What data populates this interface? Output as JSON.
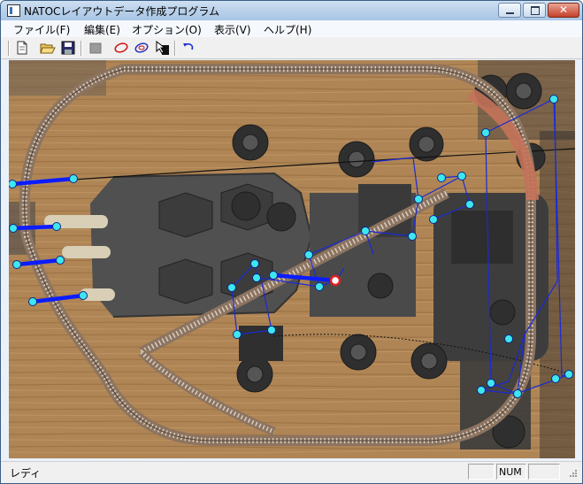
{
  "window": {
    "title": "NATOCレイアウトデータ作成プログラム",
    "close_glyph": "✕"
  },
  "menu": {
    "items": [
      {
        "label": "ファイル(F)"
      },
      {
        "label": "編集(E)"
      },
      {
        "label": "オプション(O)"
      },
      {
        "label": "表示(V)"
      },
      {
        "label": "ヘルプ(H)"
      }
    ]
  },
  "toolbar": {
    "icons": [
      "new-file-icon",
      "open-folder-icon",
      "save-disk-icon",
      "stop-square-icon",
      "red-ellipse-icon",
      "blue-ellipse-icon",
      "select-cursor-icon",
      "undo-arrow-icon"
    ]
  },
  "status": {
    "text": "レディ",
    "pane2": "NUM",
    "pane1": "",
    "pane3": ""
  },
  "colors": {
    "wood": "#b98e5c",
    "node_fill": "#3fe6f0",
    "selected_node": "#e02020",
    "thin_line": "#1a2ad6",
    "thick_line": "#0b1cff",
    "title_bar": "#b9d1ea"
  }
}
